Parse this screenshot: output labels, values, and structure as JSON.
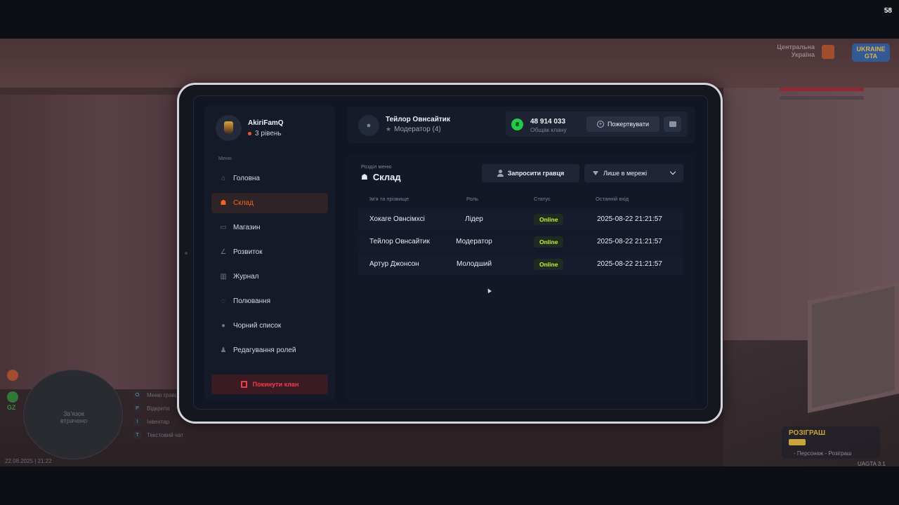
{
  "fps": "58",
  "hud": {
    "region_line1": "Центральна",
    "region_line2": "Україна",
    "logo_line1": "UKRAINE",
    "logo_line2": "GTA",
    "minimap_line1": "Зв'язок",
    "minimap_line2": "втрачено",
    "gz_label": "GZ",
    "datetime": "22.08.2025 | 21:22",
    "keys": [
      {
        "key": "O",
        "label": "Меню гравця"
      },
      {
        "key": "P",
        "label": "Відкрити"
      },
      {
        "key": "I",
        "label": "Інвентар"
      },
      {
        "key": "T",
        "label": "Текстовий чат"
      }
    ],
    "raffle_title": "РОЗІГРАШ",
    "raffle_sub": "- Персонаж - Розіграш",
    "version": "UAGTA 3.1"
  },
  "profile": {
    "name": "AkiriFamQ",
    "level": "3 рівень"
  },
  "menu": {
    "caption": "Меню",
    "items": [
      {
        "label": "Головна",
        "icon": "home-icon",
        "glyph": "⌂"
      },
      {
        "label": "Склад",
        "icon": "people-icon",
        "glyph": "☗",
        "active": true
      },
      {
        "label": "Магазин",
        "icon": "basket-icon",
        "glyph": "▭"
      },
      {
        "label": "Розвиток",
        "icon": "chart-icon",
        "glyph": "∠"
      },
      {
        "label": "Журнал",
        "icon": "book-icon",
        "glyph": "▥"
      },
      {
        "label": "Полювання",
        "icon": "target-icon",
        "glyph": "◌"
      },
      {
        "label": "Чорний список",
        "icon": "block-icon",
        "glyph": "●"
      },
      {
        "label": "Редагування ролей",
        "icon": "user-edit-icon",
        "glyph": "♟"
      }
    ],
    "leave_label": "Покинути клан"
  },
  "header": {
    "user_name": "Тейлор Овнсайтик",
    "user_role": "Модератор (4)",
    "coin_label": "₴",
    "money_value": "48 914 033",
    "money_caption": "Общак клану",
    "donate_label": "Пожертвувати"
  },
  "section": {
    "caption": "Розділ меню",
    "title": "Склад",
    "invite_label": "Запросити гравця",
    "filter_value": "Лише в мережі"
  },
  "table": {
    "columns": [
      "Ім'я та прізвище",
      "Роль",
      "Статус",
      "Останній вхід"
    ],
    "rows": [
      {
        "name": "Хокаге Овнсімхсі",
        "role": "Лідер",
        "status": "Online",
        "last": "2025-08-22 21:21:57"
      },
      {
        "name": "Тейлор Овнсайтик",
        "role": "Модератор",
        "status": "Online",
        "last": "2025-08-22 21:21:57"
      },
      {
        "name": "Артур Джонсон",
        "role": "Молодший",
        "status": "Online",
        "last": "2025-08-22 21:21:57"
      }
    ]
  }
}
